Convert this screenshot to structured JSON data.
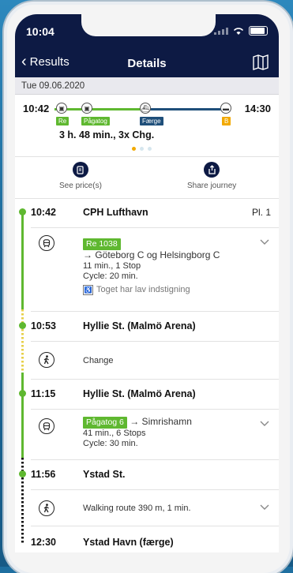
{
  "status": {
    "time": "10:04"
  },
  "nav": {
    "back_label": "Results",
    "title": "Details"
  },
  "date": "Tue 09.06.2020",
  "summary": {
    "departure": "10:42",
    "arrival": "14:30",
    "duration": "3 h. 48 min.,  3x Chg.",
    "badges": [
      "Re",
      "Pågatog",
      "Færge",
      "B"
    ],
    "colors": {
      "train": "#5fb830",
      "ferry": "#1f4f7a",
      "bus": "#f2a900"
    }
  },
  "actions": {
    "prices": "See price(s)",
    "share": "Share journey"
  },
  "stops": [
    {
      "time": "10:42",
      "name": "CPH Lufthavn",
      "platform": "Pl. 1"
    },
    {
      "time": "10:53",
      "name": "Hyllie St. (Malmö Arena)"
    },
    {
      "time": "11:15",
      "name": "Hyllie St. (Malmö Arena)"
    },
    {
      "time": "11:56",
      "name": "Ystad St."
    },
    {
      "time": "12:30",
      "name": "Ystad Havn (færge)"
    }
  ],
  "legs": [
    {
      "tag": "Re 1038",
      "line1": "→ Göteborg C og Helsingborg C",
      "line2": "11 min., 1 Stop",
      "line3": "Cycle: 20 min.",
      "note": "Toget har lav indstigning"
    },
    {
      "text": "Change"
    },
    {
      "tag": "Pågatog 6",
      "dest": " → Simrishamn",
      "line2": "41 min., 6 Stops",
      "line3": "Cycle: 30 min."
    },
    {
      "text": "Walking route 390 m, 1 min."
    }
  ]
}
